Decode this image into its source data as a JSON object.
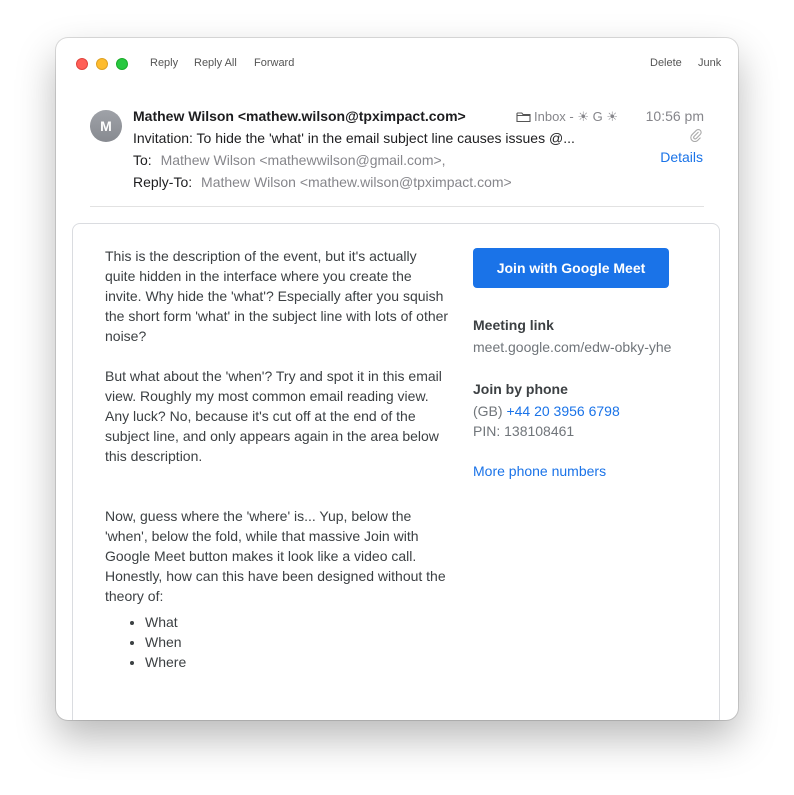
{
  "toolbar": {
    "reply": "Reply",
    "reply_all": "Reply All",
    "forward": "Forward",
    "delete": "Delete",
    "junk": "Junk"
  },
  "message": {
    "avatar_initial": "M",
    "from": "Mathew Wilson <mathew.wilson@tpximpact.com>",
    "subject": "Invitation: To hide the 'what' in the email subject line causes issues @...",
    "to_label": "To:",
    "to_value": "Mathew Wilson <mathewwilson@gmail.com>,",
    "reply_to_label": "Reply-To:",
    "reply_to_value": "Mathew Wilson <mathew.wilson@tpximpact.com>",
    "mailbox": "Inbox - ☀ G ☀",
    "time": "10:56 pm",
    "details": "Details"
  },
  "body": {
    "paragraph1": "This is the description of the event, but it's actually quite hidden in the interface where you create the invite. Why hide the 'what'? Especially after you squish the short form 'what' in the subject line with lots of other noise?",
    "paragraph2": "But what about the 'when'? Try and spot it in this email view. Roughly my most common email reading view. Any luck? No, because it's cut off at the end of the subject line, and only appears again in the area below this description.",
    "paragraph3": "Now, guess where the 'where' is... Yup, below the 'when', below the fold, while that massive Join with Google Meet button makes it look like a video call. Honestly, how can this have been designed without the theory of:",
    "list": [
      "What",
      "When",
      "Where"
    ]
  },
  "meet": {
    "button": "Join with Google Meet",
    "meeting_link_title": "Meeting link",
    "meeting_link": "meet.google.com/edw-obky-yhe",
    "phone_title": "Join by phone",
    "phone_country": "(GB)",
    "phone_number": "+44 20 3956 6798",
    "pin": "PIN: 138108461",
    "more_numbers": "More phone numbers"
  },
  "colors": {
    "accent": "#1a73e8",
    "close": "#ff5f57",
    "minimize": "#febc2e",
    "maximize": "#28c840"
  }
}
